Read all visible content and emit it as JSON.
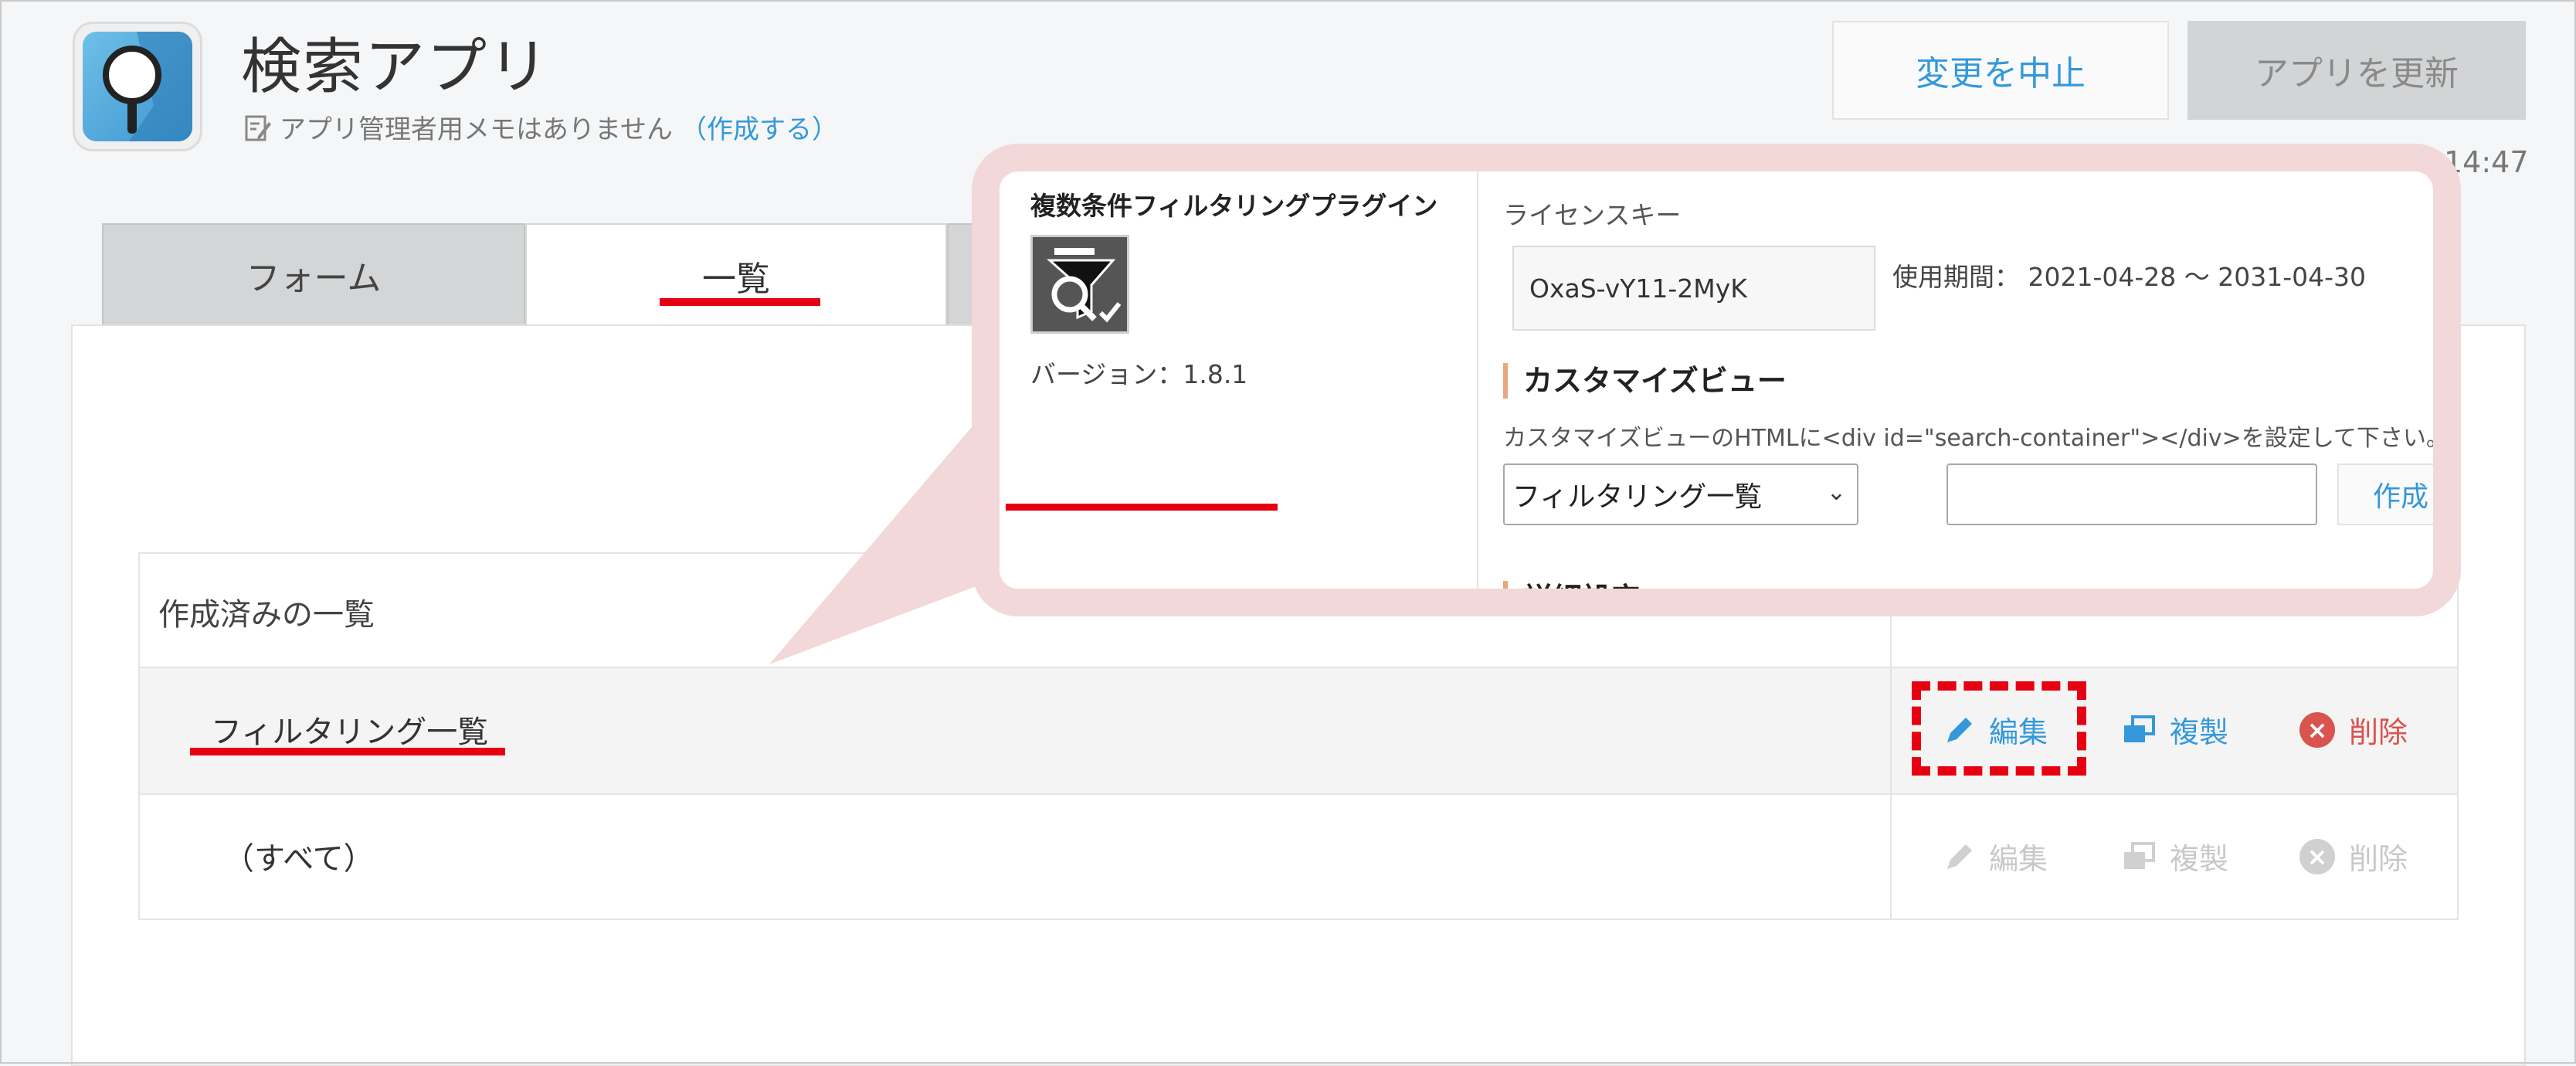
{
  "header": {
    "app_title": "検索アプリ",
    "memo_text": "アプリ管理者用メモはありません",
    "memo_link": "（作成する）",
    "cancel_label": "変更を中止",
    "update_label": "アプリを更新",
    "time": "14:47"
  },
  "tabs": [
    {
      "label": "フォーム"
    },
    {
      "label": "一覧"
    }
  ],
  "views": {
    "header_label": "作成済みの一覧",
    "rows": [
      {
        "name": "フィルタリング一覧",
        "edit": "編集",
        "copy": "複製",
        "delete": "削除"
      },
      {
        "name": "（すべて）",
        "edit": "編集",
        "copy": "複製",
        "delete": "削除"
      }
    ]
  },
  "plugin": {
    "name": "複数条件フィルタリングプラグイン",
    "version": "バージョン：1.8.1",
    "license_label": "ライセンスキー",
    "license_key": "OxaS-vY11-2MyK",
    "period": "使用期間： 2021-04-28 ～ 2031-04-30",
    "custom_view_title": "カスタマイズビュー",
    "custom_view_desc": "カスタマイズビューのHTMLに<div id=\"search-container\"></div>を設定して下さい。",
    "view_select_value": "フィルタリング一覧",
    "create_label": "作成",
    "detail_title": "詳細設定"
  },
  "colors": {
    "accent_blue": "#3498db",
    "annotation_red": "#e60012",
    "delete_red": "#d9534f"
  }
}
